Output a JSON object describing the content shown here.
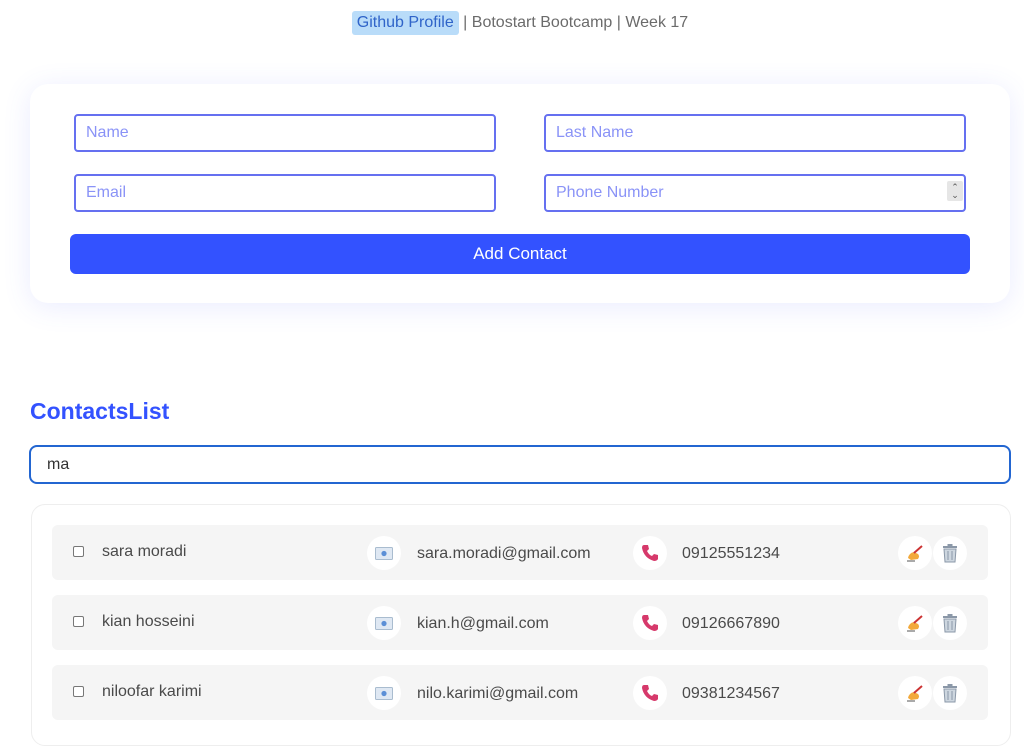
{
  "header": {
    "github_label": "Github Profile",
    "rest": " | Botostart Bootcamp | Week 17"
  },
  "form": {
    "name_placeholder": "Name",
    "last_name_placeholder": "Last Name",
    "email_placeholder": "Email",
    "phone_placeholder": "Phone Number",
    "add_button_label": "Add Contact"
  },
  "contacts": {
    "title": "ContactsList",
    "search_value": "ma",
    "items": [
      {
        "name": "sara moradi",
        "email": "sara.moradi@gmail.com",
        "phone": "09125551234"
      },
      {
        "name": "kian hosseini",
        "email": "kian.h@gmail.com",
        "phone": "09126667890"
      },
      {
        "name": "niloofar karimi",
        "email": "nilo.karimi@gmail.com",
        "phone": "09381234567"
      }
    ]
  },
  "icons": {
    "email": "envelope-icon",
    "phone": "phone-icon",
    "edit": "writing-hand-icon",
    "delete": "trash-icon"
  },
  "colors": {
    "accent": "#3352ff",
    "input_border": "#6570f0",
    "search_border": "#2366d1",
    "phone_icon": "#d6396b",
    "github_badge_bg": "#b9dcf9"
  }
}
